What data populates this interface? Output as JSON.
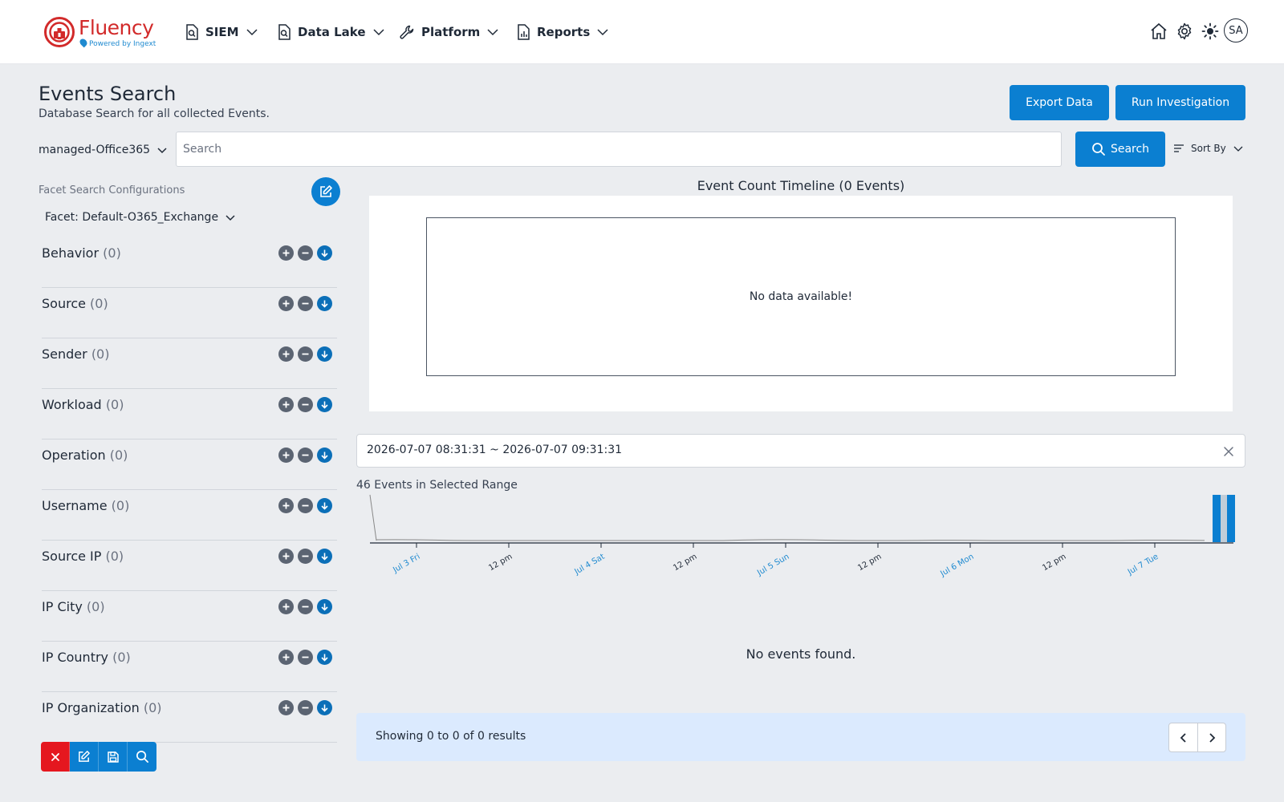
{
  "brand": {
    "name": "Fluency",
    "tagline": "Powered by Ingext",
    "color": "#d22a2a",
    "accent": "#1f8ad0"
  },
  "nav": {
    "items": [
      {
        "label": "SIEM",
        "icon": "search-doc-icon"
      },
      {
        "label": "Data Lake",
        "icon": "search-doc-icon"
      },
      {
        "label": "Platform",
        "icon": "wrench-icon"
      },
      {
        "label": "Reports",
        "icon": "report-doc-icon"
      }
    ],
    "user_initials": "SA",
    "icons": [
      "home-icon",
      "gear-icon",
      "sun-icon"
    ]
  },
  "page": {
    "title": "Events Search",
    "subtitle": "Database Search for all collected Events.",
    "export_label": "Export Data",
    "investigate_label": "Run Investigation"
  },
  "search": {
    "source": "managed-Office365",
    "placeholder": "Search",
    "value": "",
    "button_label": "Search",
    "sort_label": "Sort By"
  },
  "facets": {
    "config_label": "Facet Search Configurations",
    "selected": "Facet: Default-O365_Exchange",
    "items": [
      {
        "label": "Behavior",
        "count": "(0)"
      },
      {
        "label": "Source",
        "count": "(0)"
      },
      {
        "label": "Sender",
        "count": "(0)"
      },
      {
        "label": "Workload",
        "count": "(0)"
      },
      {
        "label": "Operation",
        "count": "(0)"
      },
      {
        "label": "Username",
        "count": "(0)"
      },
      {
        "label": "Source IP",
        "count": "(0)"
      },
      {
        "label": "IP City",
        "count": "(0)"
      },
      {
        "label": "IP Country",
        "count": "(0)"
      },
      {
        "label": "IP Organization",
        "count": "(0)"
      }
    ]
  },
  "timeline": {
    "title": "Event Count Timeline (0 Events)",
    "empty_text": "No data available!"
  },
  "range": {
    "text": "2026-07-07 08:31:31 ~ 2026-07-07 09:31:31",
    "count_text": "46 Events in Selected Range"
  },
  "chart_data": {
    "type": "area",
    "x_ticks": [
      "Jul 3 Fri",
      "12 pm",
      "Jul 4 Sat",
      "12 pm",
      "Jul 5 Sun",
      "12 pm",
      "Jul 6 Mon",
      "12 pm",
      "Jul 7 Tue"
    ],
    "day_tick_color": "#1f8ad0",
    "hour_tick_color": "#1f2937",
    "series_color": "#888888",
    "selection_color": "#0b7fd1"
  },
  "results": {
    "empty_text": "No events found.",
    "pager_text": "Showing 0 to 0 of 0 results"
  },
  "colors": {
    "primary": "#0b7fd1",
    "danger": "#e5171f",
    "background": "#ebedf0"
  }
}
